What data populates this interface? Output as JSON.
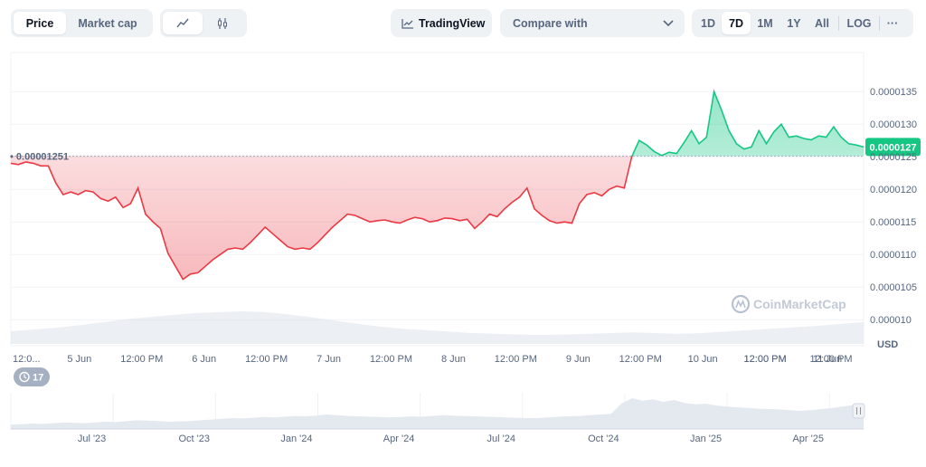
{
  "toolbar": {
    "price_tab": "Price",
    "market_cap_tab": "Market cap",
    "tradingview_label": "TradingView",
    "compare_label": "Compare with",
    "ranges": [
      "1D",
      "7D",
      "1M",
      "1Y",
      "All",
      "LOG"
    ],
    "active_range": "7D",
    "more_label": "···"
  },
  "chart_data": {
    "type": "line",
    "baseline": 1.251e-05,
    "baseline_label": "0.00001251",
    "current_price_label": "0.0000127",
    "ylim": [
      9.6e-06,
      1.41e-05
    ],
    "y_ticks": [
      1.35e-05,
      1.3e-05,
      1.25e-05,
      1.2e-05,
      1.15e-05,
      1.1e-05,
      1.05e-05,
      1e-05
    ],
    "y_tick_labels": [
      "0.0000135",
      "0.0000130",
      "0.0000125",
      "0.0000120",
      "0.0000115",
      "0.0000110",
      "0.0000105",
      "0.000010"
    ],
    "currency": "USD",
    "x_range": [
      0,
      6.2
    ],
    "x_ticks": [
      0.55,
      1.05,
      1.55,
      2.05,
      2.55,
      3.05,
      3.55,
      4.05,
      4.55,
      5.05,
      5.55,
      6.05
    ],
    "x_tick_labels": [
      "5 Jun",
      "12:00 PM",
      "6 Jun",
      "12:00 PM",
      "7 Jun",
      "12:00 PM",
      "8 Jun",
      "12:00 PM",
      "9 Jun",
      "12:00 PM",
      "10 Jun",
      "12:00 PM"
    ],
    "x_first_label": "12:0...",
    "x_last_tick": 6.75,
    "x_last_label": "12:00 PM",
    "x_extra_ticks": [
      6.05,
      6.55
    ],
    "x_extra_labels": [
      "12:00 PM",
      "11 Jun"
    ],
    "x": [
      0.0,
      0.06,
      0.12,
      0.18,
      0.24,
      0.3,
      0.36,
      0.42,
      0.48,
      0.54,
      0.6,
      0.66,
      0.72,
      0.78,
      0.84,
      0.9,
      0.96,
      1.02,
      1.08,
      1.14,
      1.2,
      1.26,
      1.32,
      1.38,
      1.44,
      1.5,
      1.56,
      1.62,
      1.68,
      1.74,
      1.8,
      1.86,
      1.92,
      1.98,
      2.04,
      2.1,
      2.16,
      2.22,
      2.28,
      2.34,
      2.4,
      2.46,
      2.52,
      2.58,
      2.64,
      2.7,
      2.76,
      2.82,
      2.88,
      2.94,
      3.0,
      3.06,
      3.12,
      3.18,
      3.24,
      3.3,
      3.36,
      3.42,
      3.48,
      3.54,
      3.6,
      3.66,
      3.72,
      3.78,
      3.84,
      3.9,
      3.96,
      4.02,
      4.08,
      4.14,
      4.2,
      4.26,
      4.32,
      4.38,
      4.44,
      4.5,
      4.56,
      4.62,
      4.68,
      4.74,
      4.8,
      4.86,
      4.92,
      4.98,
      5.04,
      5.1,
      5.16,
      5.22,
      5.28,
      5.34,
      5.4,
      5.46,
      5.52,
      5.58,
      5.64,
      5.7,
      5.76,
      5.82,
      5.88,
      5.94,
      6.0,
      6.06,
      6.12,
      6.18,
      6.24,
      6.3,
      6.36,
      6.42,
      6.48,
      6.54,
      6.6,
      6.66,
      6.72,
      6.78,
      6.84
    ],
    "y": [
      1.24e-05,
      1.238e-05,
      1.242e-05,
      1.24e-05,
      1.236e-05,
      1.236e-05,
      1.21e-05,
      1.192e-05,
      1.196e-05,
      1.192e-05,
      1.198e-05,
      1.196e-05,
      1.186e-05,
      1.182e-05,
      1.188e-05,
      1.172e-05,
      1.178e-05,
      1.202e-05,
      1.162e-05,
      1.15e-05,
      1.14e-05,
      1.102e-05,
      1.082e-05,
      1.062e-05,
      1.07e-05,
      1.072e-05,
      1.082e-05,
      1.092e-05,
      1.1e-05,
      1.108e-05,
      1.11e-05,
      1.108e-05,
      1.118e-05,
      1.13e-05,
      1.142e-05,
      1.132e-05,
      1.122e-05,
      1.112e-05,
      1.108e-05,
      1.11e-05,
      1.108e-05,
      1.118e-05,
      1.13e-05,
      1.142e-05,
      1.152e-05,
      1.162e-05,
      1.16e-05,
      1.155e-05,
      1.15e-05,
      1.152e-05,
      1.153e-05,
      1.15e-05,
      1.148e-05,
      1.153e-05,
      1.157e-05,
      1.155e-05,
      1.15e-05,
      1.152e-05,
      1.156e-05,
      1.155e-05,
      1.152e-05,
      1.154e-05,
      1.14e-05,
      1.15e-05,
      1.162e-05,
      1.158e-05,
      1.17e-05,
      1.18e-05,
      1.188e-05,
      1.202e-05,
      1.17e-05,
      1.16e-05,
      1.152e-05,
      1.148e-05,
      1.15e-05,
      1.148e-05,
      1.178e-05,
      1.192e-05,
      1.195e-05,
      1.19e-05,
      1.2e-05,
      1.205e-05,
      1.202e-05,
      1.25e-05,
      1.275e-05,
      1.268e-05,
      1.258e-05,
      1.252e-05,
      1.257e-05,
      1.255e-05,
      1.272e-05,
      1.29e-05,
      1.27e-05,
      1.28e-05,
      1.35e-05,
      1.322e-05,
      1.29e-05,
      1.27e-05,
      1.262e-05,
      1.265e-05,
      1.29e-05,
      1.27e-05,
      1.288e-05,
      1.3e-05,
      1.28e-05,
      1.282e-05,
      1.278e-05,
      1.276e-05,
      1.282e-05,
      1.28e-05,
      1.296e-05,
      1.28e-05,
      1.27e-05,
      1.268e-05,
      1.265e-05
    ]
  },
  "volume": {
    "values": [
      0.35,
      0.4,
      0.45,
      0.52,
      0.6,
      0.68,
      0.74,
      0.8,
      0.85,
      0.88,
      0.9,
      0.88,
      0.82,
      0.74,
      0.65,
      0.56,
      0.48,
      0.42,
      0.38,
      0.34,
      0.3,
      0.28,
      0.26,
      0.25,
      0.26,
      0.28,
      0.3,
      0.32,
      0.3,
      0.28,
      0.3,
      0.34,
      0.38,
      0.42,
      0.46,
      0.5,
      0.55,
      0.6
    ]
  },
  "navigator": {
    "tick_labels": [
      "Jul '23",
      "Oct '23",
      "Jan '24",
      "Apr '24",
      "Jul '24",
      "Oct '24",
      "Jan '25",
      "Apr '25"
    ],
    "tick_x": [
      0.12,
      0.24,
      0.36,
      0.48,
      0.6,
      0.72,
      0.84,
      0.96
    ],
    "badge_label": "17",
    "values": [
      0.12,
      0.13,
      0.15,
      0.14,
      0.16,
      0.18,
      0.17,
      0.16,
      0.18,
      0.2,
      0.19,
      0.22,
      0.24,
      0.23,
      0.22,
      0.2,
      0.21,
      0.22,
      0.24,
      0.26,
      0.28,
      0.3,
      0.29,
      0.31,
      0.33,
      0.32,
      0.34,
      0.36,
      0.35,
      0.37,
      0.4,
      0.38,
      0.36,
      0.35,
      0.34,
      0.33,
      0.32,
      0.33,
      0.35,
      0.34,
      0.36,
      0.38,
      0.37,
      0.36,
      0.35,
      0.34,
      0.33,
      0.32,
      0.31,
      0.3,
      0.3,
      0.32,
      0.34,
      0.35,
      0.36,
      0.38,
      0.4,
      0.42,
      0.7,
      0.85,
      0.78,
      0.82,
      0.75,
      0.8,
      0.72,
      0.68,
      0.7,
      0.65,
      0.62,
      0.6,
      0.58,
      0.56,
      0.55,
      0.54,
      0.52,
      0.5,
      0.52,
      0.55,
      0.58,
      0.62,
      0.66,
      0.72
    ]
  },
  "watermark": "CoinMarketCap",
  "colors": {
    "up": "#16c784",
    "down": "#ea3943",
    "grid": "#eff2f5",
    "baseline": "#a6b0c3"
  }
}
